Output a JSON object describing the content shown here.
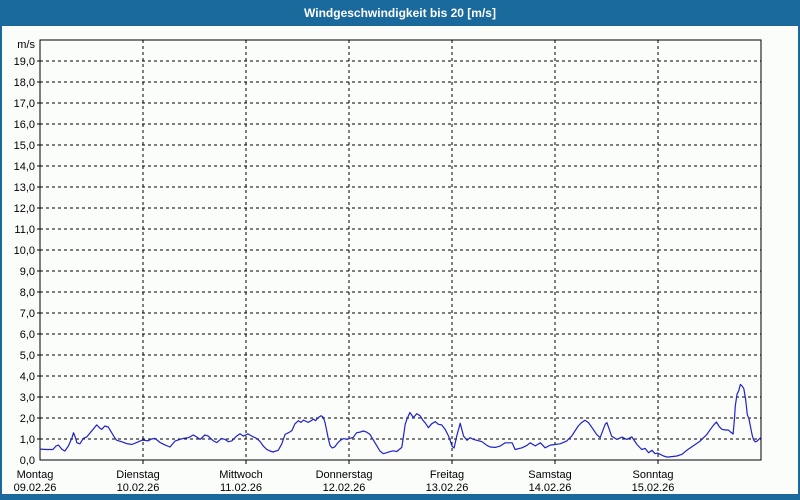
{
  "window": {
    "title": "Windgeschwindigkeit bis 20 [m/s]",
    "colors": {
      "frame": "#1a699c",
      "content_bg": "#fbfdfb",
      "title_text": "#ffffff",
      "grid": "#000000",
      "text": "#000000",
      "line": "#2222c8"
    }
  },
  "chart_data": {
    "type": "line",
    "title": "Windgeschwindigkeit bis 20 [m/s]",
    "ylabel": "m/s",
    "ylim": [
      0,
      20
    ],
    "ytick_step": 1,
    "ytick_labels": [
      "0,0",
      "1,0",
      "2,0",
      "3,0",
      "4,0",
      "5,0",
      "6,0",
      "7,0",
      "8,0",
      "9,0",
      "10,0",
      "11,0",
      "12,0",
      "13,0",
      "14,0",
      "15,0",
      "16,0",
      "17,0",
      "18,0",
      "19,0"
    ],
    "x_unit": "hours",
    "xlim": [
      0,
      168
    ],
    "grid": "dashed-black",
    "legend": "none",
    "days": [
      {
        "name": "Montag",
        "date": "09.02.26"
      },
      {
        "name": "Dienstag",
        "date": "10.02.26"
      },
      {
        "name": "Mittwoch",
        "date": "11.02.26"
      },
      {
        "name": "Donnerstag",
        "date": "12.02.26"
      },
      {
        "name": "Freitag",
        "date": "13.02.26"
      },
      {
        "name": "Samstag",
        "date": "14.02.26"
      },
      {
        "name": "Sonntag",
        "date": "15.02.26"
      }
    ],
    "series": [
      {
        "name": "Windgeschwindigkeit",
        "points": [
          [
            0,
            0.52
          ],
          [
            1.5,
            0.5
          ],
          [
            3,
            0.5
          ],
          [
            3.7,
            0.66
          ],
          [
            4.3,
            0.71
          ],
          [
            5.1,
            0.51
          ],
          [
            5.8,
            0.43
          ],
          [
            6.6,
            0.66
          ],
          [
            7.4,
            1.03
          ],
          [
            7.8,
            1.3
          ],
          [
            8.2,
            1.1
          ],
          [
            8.6,
            0.82
          ],
          [
            9.3,
            0.77
          ],
          [
            10.1,
            1.03
          ],
          [
            10.9,
            1.1
          ],
          [
            11.7,
            1.3
          ],
          [
            12.4,
            1.46
          ],
          [
            13.2,
            1.67
          ],
          [
            14,
            1.51
          ],
          [
            14.4,
            1.46
          ],
          [
            15.1,
            1.62
          ],
          [
            15.9,
            1.57
          ],
          [
            16.7,
            1.3
          ],
          [
            17.5,
            1.03
          ],
          [
            17.9,
            0.94
          ],
          [
            19,
            0.87
          ],
          [
            20.2,
            0.78
          ],
          [
            21.4,
            0.74
          ],
          [
            22.5,
            0.83
          ],
          [
            23.7,
            0.94
          ],
          [
            24.1,
            0.95
          ],
          [
            25.2,
            0.91
          ],
          [
            26,
            1.0
          ],
          [
            26.8,
            1.03
          ],
          [
            28,
            0.83
          ],
          [
            29.1,
            0.72
          ],
          [
            30.3,
            0.62
          ],
          [
            31.5,
            0.91
          ],
          [
            32.6,
            0.98
          ],
          [
            33.4,
            1.03
          ],
          [
            34.6,
            1.06
          ],
          [
            35.7,
            1.19
          ],
          [
            36.5,
            1.1
          ],
          [
            37.3,
            0.98
          ],
          [
            38.4,
            1.19
          ],
          [
            39.2,
            1.14
          ],
          [
            40.4,
            0.91
          ],
          [
            41.2,
            0.83
          ],
          [
            42.3,
            1.03
          ],
          [
            43.1,
            0.98
          ],
          [
            43.9,
            0.87
          ],
          [
            44.7,
            0.91
          ],
          [
            45.8,
            1.14
          ],
          [
            46.6,
            1.25
          ],
          [
            47.4,
            1.14
          ],
          [
            48.2,
            1.22
          ],
          [
            48.4,
            1.25
          ],
          [
            48.9,
            1.19
          ],
          [
            49.7,
            1.1
          ],
          [
            50.5,
            1.03
          ],
          [
            51.3,
            0.87
          ],
          [
            52,
            0.67
          ],
          [
            52.8,
            0.51
          ],
          [
            53.6,
            0.43
          ],
          [
            54.3,
            0.38
          ],
          [
            55.5,
            0.46
          ],
          [
            56.3,
            0.75
          ],
          [
            56.7,
            0.98
          ],
          [
            57.1,
            1.22
          ],
          [
            57.9,
            1.3
          ],
          [
            58.7,
            1.4
          ],
          [
            59.4,
            1.72
          ],
          [
            60.2,
            1.87
          ],
          [
            60.8,
            1.79
          ],
          [
            61.4,
            1.9
          ],
          [
            62,
            1.84
          ],
          [
            62.5,
            1.79
          ],
          [
            63.2,
            1.87
          ],
          [
            63.7,
            1.95
          ],
          [
            64.2,
            1.87
          ],
          [
            64.9,
            2.03
          ],
          [
            65.5,
            2.11
          ],
          [
            66,
            2.03
          ],
          [
            66.4,
            1.79
          ],
          [
            66.8,
            1.4
          ],
          [
            67.2,
            1.0
          ],
          [
            67.6,
            0.68
          ],
          [
            68.1,
            0.57
          ],
          [
            68.7,
            0.63
          ],
          [
            69.5,
            0.85
          ],
          [
            70.3,
            0.98
          ],
          [
            70.8,
            1.02
          ],
          [
            71.5,
            0.98
          ],
          [
            72.1,
            1.02
          ],
          [
            73,
            1.08
          ],
          [
            73.8,
            1.3
          ],
          [
            74.6,
            1.33
          ],
          [
            75.3,
            1.38
          ],
          [
            76.1,
            1.33
          ],
          [
            76.9,
            1.22
          ],
          [
            77.7,
            0.94
          ],
          [
            78.5,
            0.67
          ],
          [
            79.2,
            0.43
          ],
          [
            80,
            0.3
          ],
          [
            80.8,
            0.35
          ],
          [
            81.6,
            0.4
          ],
          [
            82.3,
            0.44
          ],
          [
            83.1,
            0.4
          ],
          [
            84.3,
            0.6
          ],
          [
            84.7,
            1.14
          ],
          [
            85.1,
            1.7
          ],
          [
            85.5,
            1.94
          ],
          [
            86.2,
            2.26
          ],
          [
            87,
            2.02
          ],
          [
            87.8,
            2.21
          ],
          [
            88.6,
            2.1
          ],
          [
            89.3,
            1.87
          ],
          [
            89.7,
            1.78
          ],
          [
            90.5,
            1.54
          ],
          [
            91.3,
            1.73
          ],
          [
            92.1,
            1.83
          ],
          [
            92.8,
            1.7
          ],
          [
            93.6,
            1.67
          ],
          [
            94.4,
            1.46
          ],
          [
            95.2,
            1.14
          ],
          [
            96,
            0.67
          ],
          [
            96.2,
            0.62
          ],
          [
            96.5,
            0.57
          ],
          [
            97.1,
            1.14
          ],
          [
            97.9,
            1.75
          ],
          [
            98.7,
            1.14
          ],
          [
            99.5,
            0.94
          ],
          [
            100.2,
            1.06
          ],
          [
            101,
            0.98
          ],
          [
            101.8,
            0.94
          ],
          [
            103,
            0.87
          ],
          [
            104.1,
            0.7
          ],
          [
            104.9,
            0.62
          ],
          [
            106.1,
            0.6
          ],
          [
            107.2,
            0.66
          ],
          [
            108.4,
            0.82
          ],
          [
            110,
            0.82
          ],
          [
            110.7,
            0.5
          ],
          [
            112.3,
            0.58
          ],
          [
            113.5,
            0.7
          ],
          [
            114.2,
            0.82
          ],
          [
            115.4,
            0.67
          ],
          [
            116.6,
            0.82
          ],
          [
            117.7,
            0.58
          ],
          [
            118.9,
            0.71
          ],
          [
            120,
            0.74
          ],
          [
            121.2,
            0.77
          ],
          [
            122.7,
            0.9
          ],
          [
            123.9,
            1.14
          ],
          [
            125.4,
            1.62
          ],
          [
            126.2,
            1.78
          ],
          [
            127,
            1.89
          ],
          [
            127.8,
            1.78
          ],
          [
            128.9,
            1.46
          ],
          [
            129.7,
            1.22
          ],
          [
            130.5,
            1.06
          ],
          [
            131.7,
            1.7
          ],
          [
            132.1,
            1.78
          ],
          [
            133.2,
            1.14
          ],
          [
            134.4,
            0.98
          ],
          [
            135.6,
            1.09
          ],
          [
            136.7,
            0.98
          ],
          [
            137.9,
            1.1
          ],
          [
            139.1,
            0.74
          ],
          [
            140.2,
            0.5
          ],
          [
            141,
            0.55
          ],
          [
            141.8,
            0.35
          ],
          [
            142.6,
            0.46
          ],
          [
            143.3,
            0.3
          ],
          [
            143.9,
            0.33
          ],
          [
            144.5,
            0.27
          ],
          [
            145.3,
            0.19
          ],
          [
            146.1,
            0.14
          ],
          [
            147.2,
            0.16
          ],
          [
            148.4,
            0.19
          ],
          [
            149.6,
            0.27
          ],
          [
            150.7,
            0.46
          ],
          [
            151.9,
            0.63
          ],
          [
            153.1,
            0.8
          ],
          [
            153.8,
            0.9
          ],
          [
            154.6,
            1.06
          ],
          [
            155.4,
            1.22
          ],
          [
            156.2,
            1.46
          ],
          [
            156.9,
            1.65
          ],
          [
            157.6,
            1.81
          ],
          [
            158.3,
            1.58
          ],
          [
            158.9,
            1.46
          ],
          [
            159.7,
            1.43
          ],
          [
            160.4,
            1.43
          ],
          [
            160.8,
            1.35
          ],
          [
            161.5,
            1.24
          ],
          [
            161.8,
            1.94
          ],
          [
            162,
            2.57
          ],
          [
            162.4,
            3.13
          ],
          [
            162.8,
            3.29
          ],
          [
            163.2,
            3.6
          ],
          [
            163.6,
            3.52
          ],
          [
            164,
            3.4
          ],
          [
            164.4,
            2.9
          ],
          [
            164.8,
            2.16
          ],
          [
            165.2,
            1.94
          ],
          [
            165.6,
            1.54
          ],
          [
            166,
            1.14
          ],
          [
            166.3,
            0.95
          ],
          [
            166.7,
            0.86
          ],
          [
            167.1,
            0.9
          ],
          [
            167.9,
            1.06
          ]
        ]
      }
    ]
  }
}
